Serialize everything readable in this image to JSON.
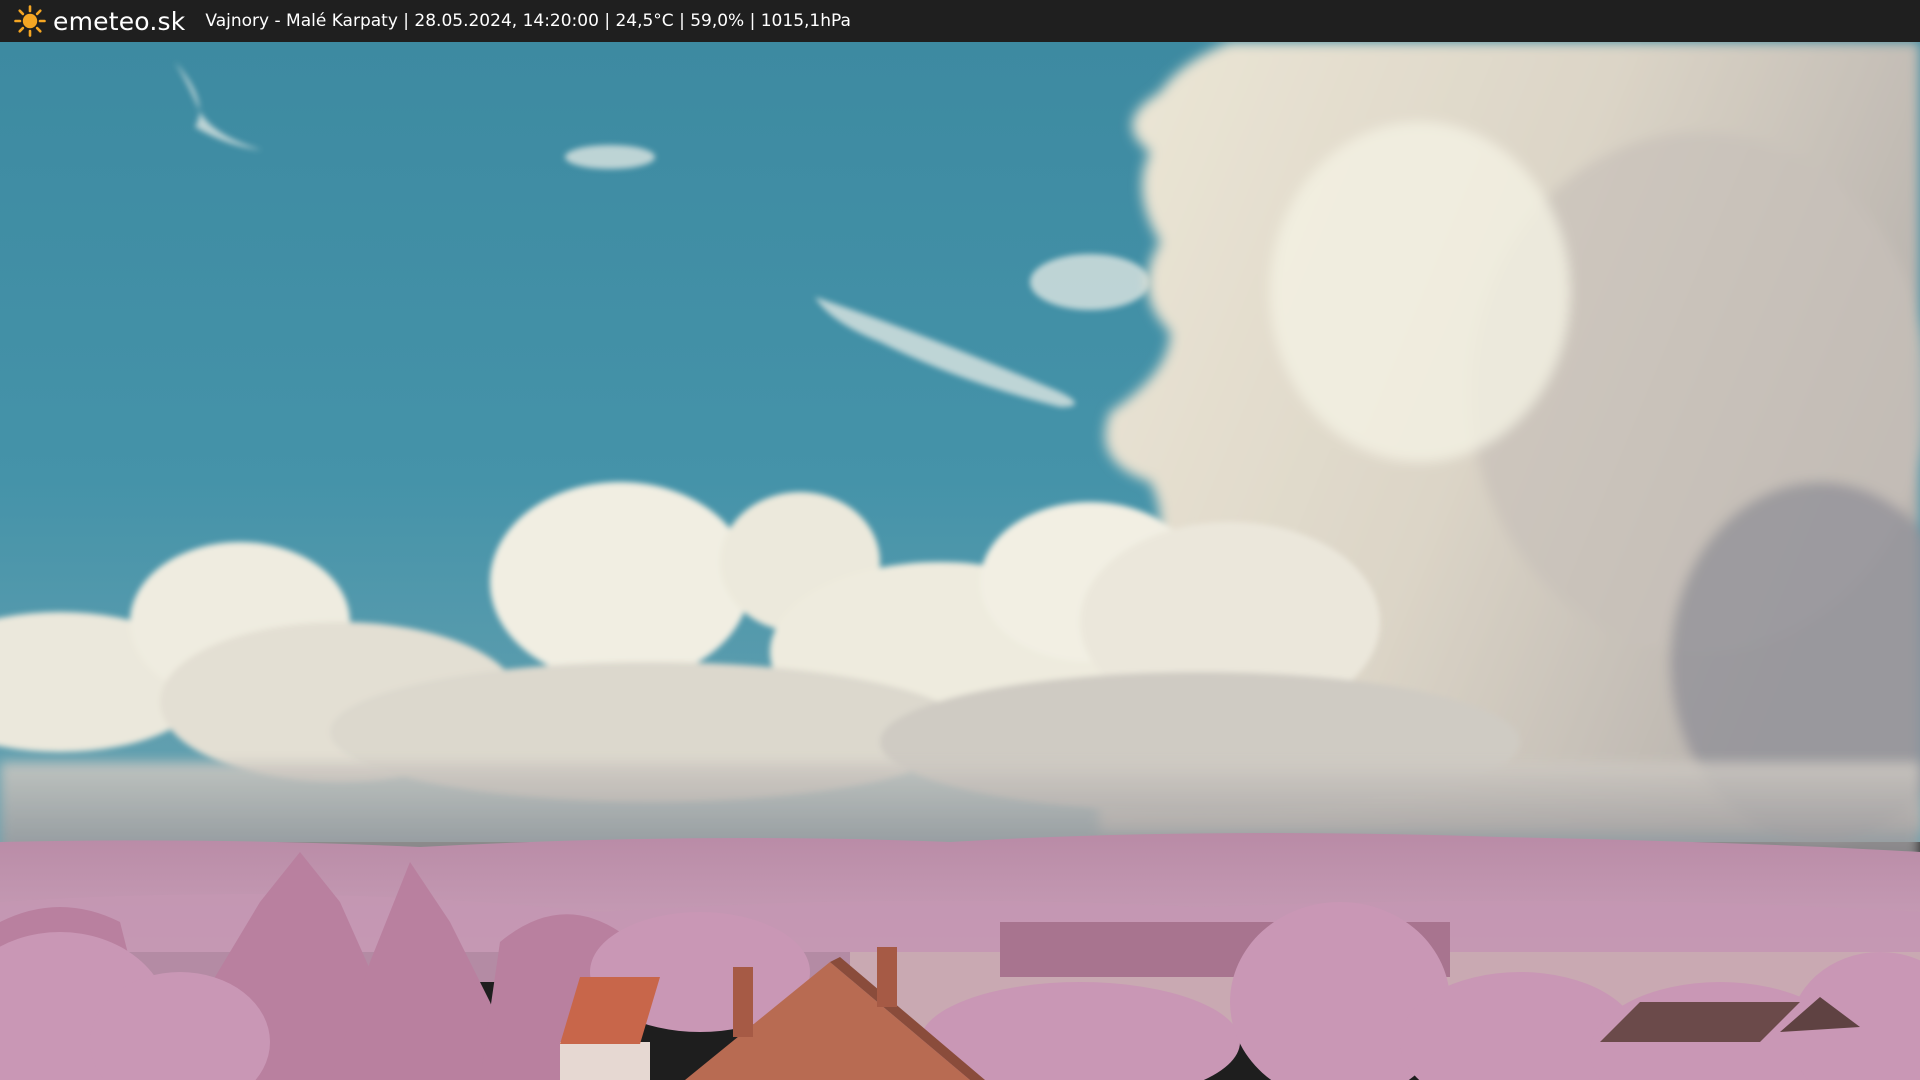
{
  "header": {
    "brand": "emeteo.sk",
    "logo_icon": "sun-icon",
    "caption": "Vajnory - Malé Karpaty | 28.05.2024, 14:20:00 | 24,5°C | 59,0% | 1015,1hPa"
  },
  "colors": {
    "bar_background": "#1f1f1f",
    "sun": "#f5a623",
    "sky": "#3f8fa5",
    "cloud": "#f1eedf",
    "foliage": "#c79ab5",
    "roof": "#c8664a"
  }
}
